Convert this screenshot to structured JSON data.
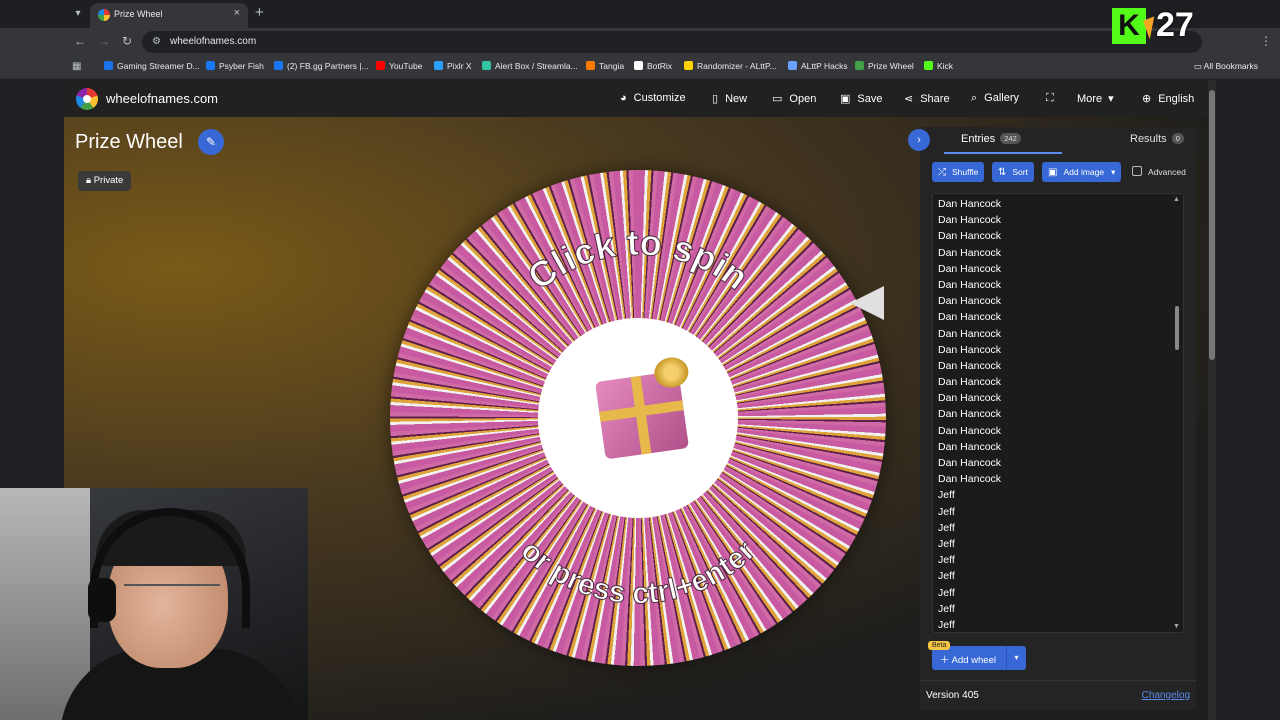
{
  "browser": {
    "tab_title": "Prize Wheel",
    "tab_menu_icon": "chevron-down-icon",
    "new_tab_glyph": "+",
    "close_glyph": "×",
    "url": "wheelofnames.com",
    "bookmarks": [
      {
        "label": "Gaming Streamer D...",
        "color": "#1a73e8"
      },
      {
        "label": "Psyber Fish",
        "color": "#1877f2"
      },
      {
        "label": "(2) FB.gg Partners |...",
        "color": "#1877f2"
      },
      {
        "label": "YouTube",
        "color": "#ff0000"
      },
      {
        "label": "Pixlr X",
        "color": "#2aa1ff"
      },
      {
        "label": "Alert Box / Streamla...",
        "color": "#31c3a2"
      },
      {
        "label": "Tangia",
        "color": "#ff7a00"
      },
      {
        "label": "BotRix",
        "color": "#ffffff"
      },
      {
        "label": "Randomizer - ALttP...",
        "color": "#ffd400"
      },
      {
        "label": "ALttP Hacks",
        "color": "#6aa0ff"
      },
      {
        "label": "Prize Wheel",
        "color": "#43a047"
      },
      {
        "label": "Kick",
        "color": "#53fc18"
      }
    ],
    "all_bookmarks": "All Bookmarks"
  },
  "header": {
    "site_name": "wheelofnames.com",
    "nav": [
      {
        "label": "Customize",
        "icon": "palette-icon",
        "glyph": "◕"
      },
      {
        "label": "New",
        "icon": "file-icon",
        "glyph": "▯"
      },
      {
        "label": "Open",
        "icon": "folder-open-icon",
        "glyph": "▭"
      },
      {
        "label": "Save",
        "icon": "save-icon",
        "glyph": "▣"
      },
      {
        "label": "Share",
        "icon": "share-icon",
        "glyph": "⋖"
      },
      {
        "label": "Gallery",
        "icon": "search-icon",
        "glyph": "⌕"
      },
      {
        "label": "",
        "icon": "fullscreen-icon",
        "glyph": "⛶"
      },
      {
        "label": "More",
        "icon": "chevron-down-icon",
        "glyph": "▾"
      },
      {
        "label": "English",
        "icon": "globe-icon",
        "glyph": "⊕"
      }
    ]
  },
  "page": {
    "title": "Prize Wheel",
    "private_label": "Private",
    "wheel_prompt_top": "Click to spin",
    "wheel_prompt_bottom": "or press ctrl+enter"
  },
  "sidebar": {
    "entries_tab": "Entries",
    "entries_count": "242",
    "results_tab": "Results",
    "results_count": "0",
    "shuffle": "Shuffle",
    "sort": "Sort",
    "add_image": "Add image",
    "advanced": "Advanced",
    "entries": [
      "Dan Hancock",
      "Dan Hancock",
      "Dan Hancock",
      "Dan Hancock",
      "Dan Hancock",
      "Dan Hancock",
      "Dan Hancock",
      "Dan Hancock",
      "Dan Hancock",
      "Dan Hancock",
      "Dan Hancock",
      "Dan Hancock",
      "Dan Hancock",
      "Dan Hancock",
      "Dan Hancock",
      "Dan Hancock",
      "Dan Hancock",
      "Dan Hancock",
      "Jeff",
      "Jeff",
      "Jeff",
      "Jeff",
      "Jeff",
      "Jeff",
      "Jeff",
      "Jeff",
      "Jeff"
    ],
    "beta": "Beta",
    "add_wheel": "Add wheel",
    "version": "Version 405",
    "changelog": "Changelog"
  },
  "overlay": {
    "k_logo": "K",
    "counter": "27"
  }
}
